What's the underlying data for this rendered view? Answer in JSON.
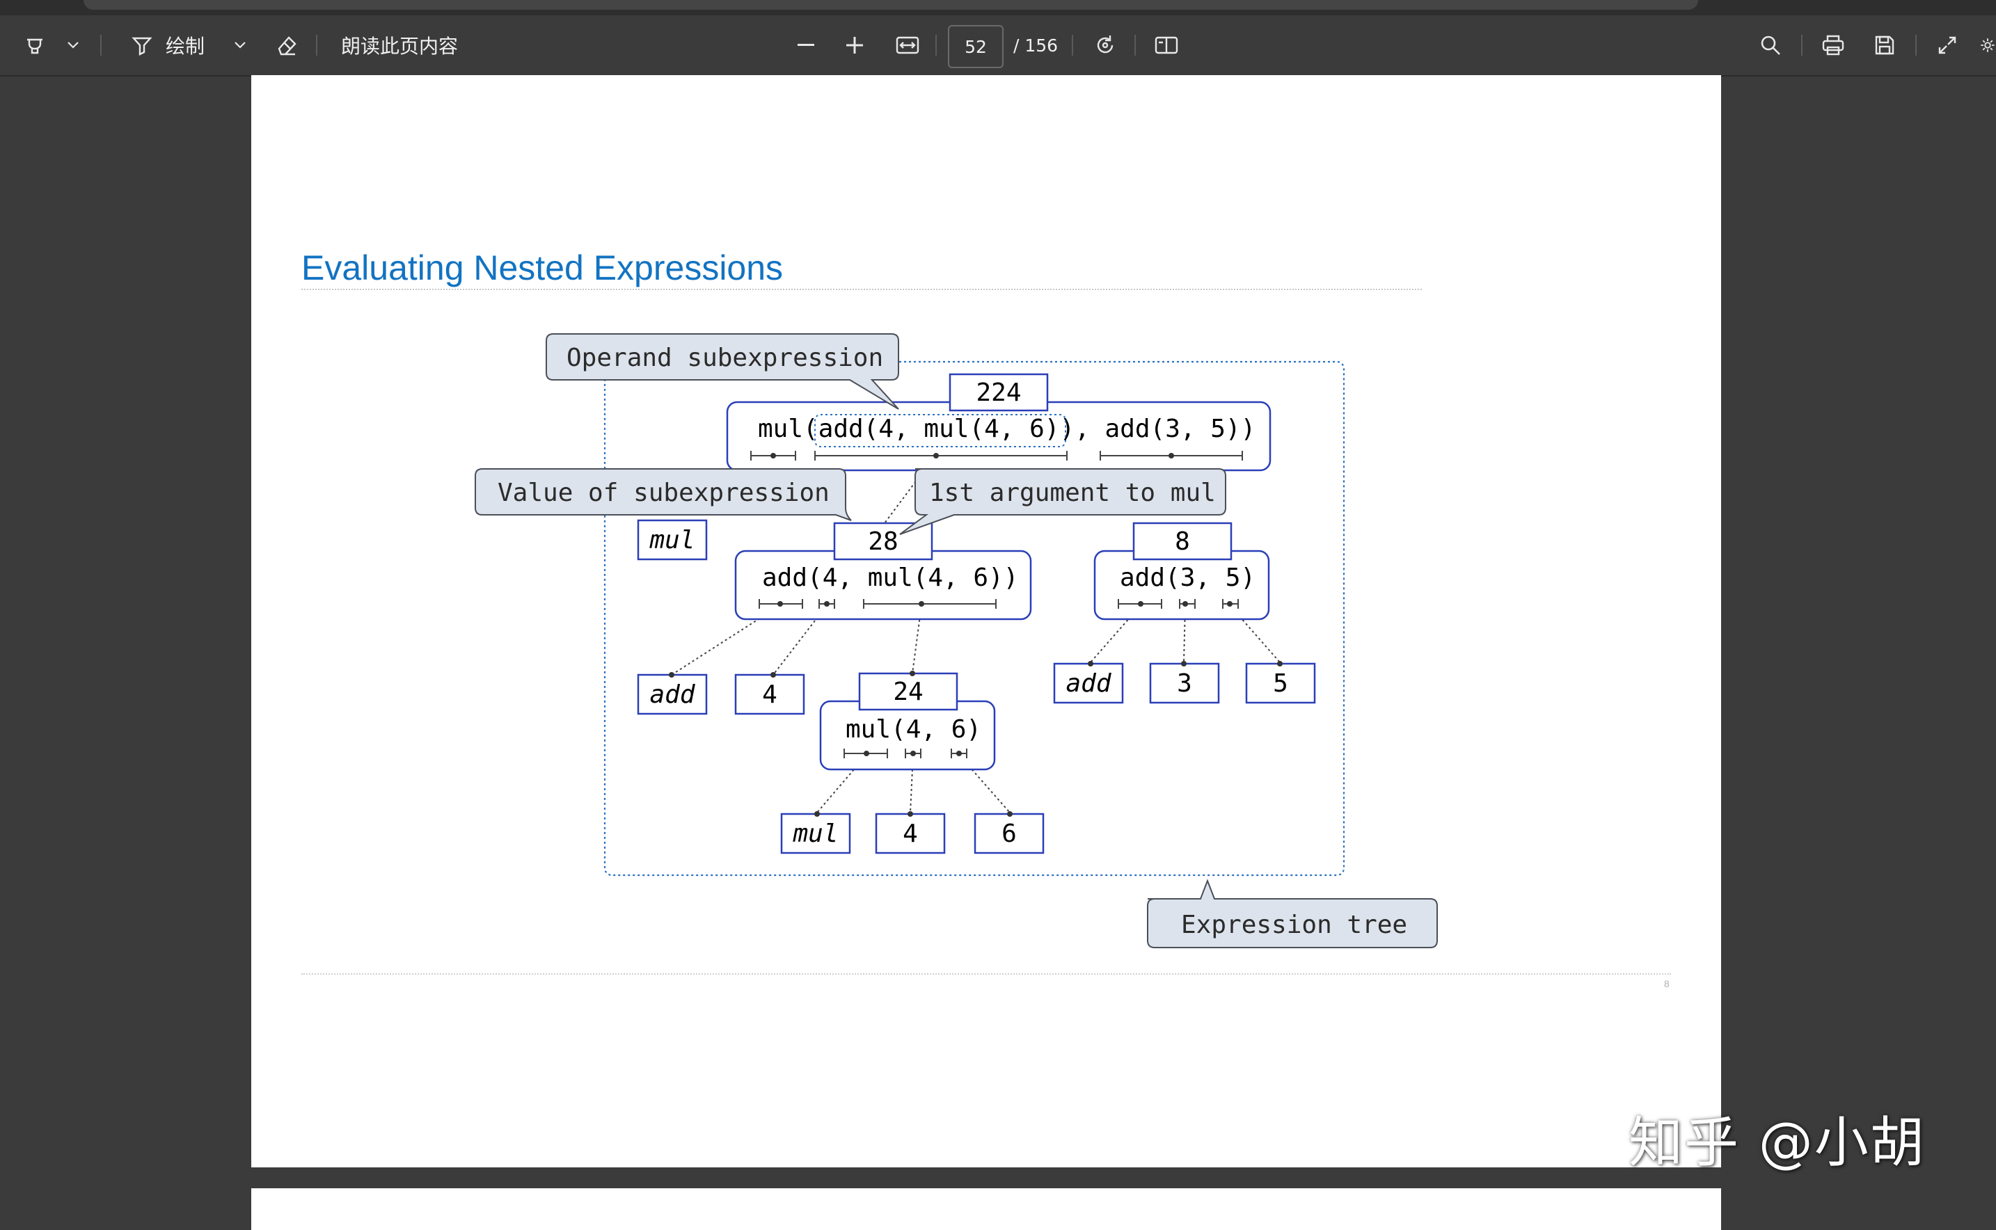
{
  "toolbar": {
    "draw_label": "绘制",
    "read_aloud_label": "朗读此页内容",
    "page_current": "52",
    "page_total": "/ 156"
  },
  "slide": {
    "title": "Evaluating Nested Expressions",
    "page_number": "8"
  },
  "diagram": {
    "callouts": {
      "operand": "Operand subexpression",
      "value": "Value of subexpression",
      "first_arg": "1st argument to mul",
      "tree": "Expression tree"
    },
    "root": {
      "value": "224",
      "pre": "mul(",
      "operand": "add(4, mul(4, 6))",
      "post": ", add(3, 5))"
    },
    "left": {
      "value": "28",
      "expr": "add(4, mul(4, 6))"
    },
    "right": {
      "value": "8",
      "expr": "add(3, 5)"
    },
    "inner": {
      "value": "24",
      "expr": "mul(4, 6)"
    },
    "leaves": {
      "mul_root": "mul",
      "add_left": "add",
      "four_left": "4",
      "add_right": "add",
      "three": "3",
      "five": "5",
      "mul_inner": "mul",
      "four_inner": "4",
      "six": "6"
    }
  },
  "watermark": "知乎 @小胡",
  "colors": {
    "title_blue": "#1273c2",
    "box_blue": "#2a3fb8",
    "callout_fill": "#dde3ec",
    "tree_border": "#2a6fc0"
  }
}
